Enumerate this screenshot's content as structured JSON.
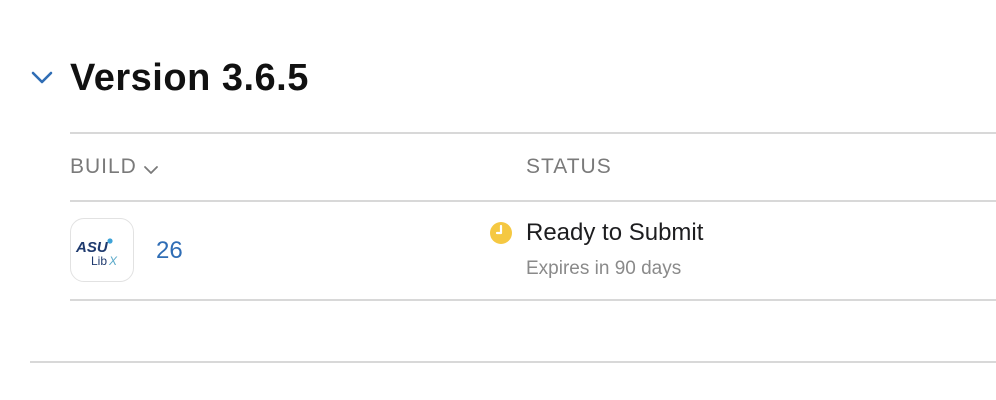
{
  "version": {
    "title": "Version 3.6.5"
  },
  "table": {
    "columns": {
      "build": "BUILD",
      "status": "STATUS"
    },
    "rows": [
      {
        "build_number": "26",
        "status": "Ready to Submit",
        "status_detail": "Expires in 90 days",
        "status_color": "#f5c842"
      }
    ]
  },
  "app_icon": {
    "logo_text_top": "ASU",
    "logo_text_bottom": "LibX"
  },
  "colors": {
    "accent": "#2f6db5",
    "status_ready": "#f5c842",
    "divider": "#d8d8d8"
  },
  "icons": {
    "collapse": "chevron-down-icon",
    "sort": "chevron-down-icon",
    "status": "clock-icon"
  }
}
